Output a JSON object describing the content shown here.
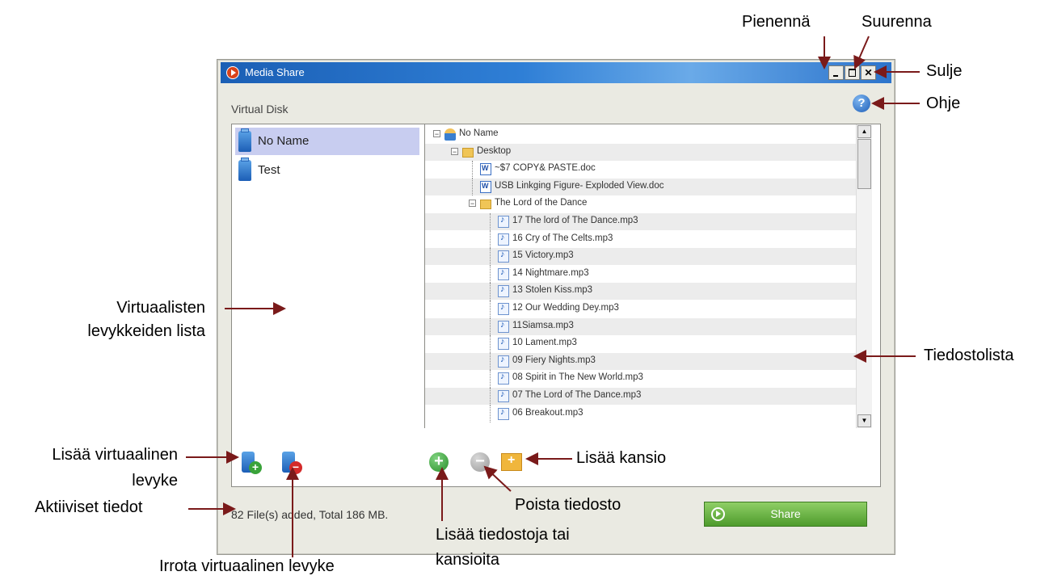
{
  "window": {
    "title": "Media Share",
    "section_label": "Virtual Disk",
    "help_label": "?",
    "close_symbol": "✕"
  },
  "disks": [
    {
      "name": "No Name",
      "selected": true
    },
    {
      "name": "Test",
      "selected": false
    }
  ],
  "tree": [
    {
      "label": "No Name",
      "icon": "user-icon",
      "level": 0,
      "toggle": "−"
    },
    {
      "label": "Desktop",
      "icon": "folder-icon",
      "level": 1,
      "toggle": "−"
    },
    {
      "label": "~$7 COPY& PASTE.doc",
      "icon": "doc-icon",
      "level": 2
    },
    {
      "label": "USB Linkging Figure- Exploded View.doc",
      "icon": "doc-icon",
      "level": 2
    },
    {
      "label": "The Lord of the Dance",
      "icon": "folder-icon",
      "level": 2,
      "toggle": "−"
    },
    {
      "label": "17 The lord of The Dance.mp3",
      "icon": "mp3-icon",
      "level": 3
    },
    {
      "label": "16 Cry of The Celts.mp3",
      "icon": "mp3-icon",
      "level": 3
    },
    {
      "label": "15 Victory.mp3",
      "icon": "mp3-icon",
      "level": 3
    },
    {
      "label": "14 Nightmare.mp3",
      "icon": "mp3-icon",
      "level": 3
    },
    {
      "label": "13 Stolen Kiss.mp3",
      "icon": "mp3-icon",
      "level": 3
    },
    {
      "label": "12 Our Wedding Dey.mp3",
      "icon": "mp3-icon",
      "level": 3
    },
    {
      "label": "11Siamsa.mp3",
      "icon": "mp3-icon",
      "level": 3
    },
    {
      "label": "10 Lament.mp3",
      "icon": "mp3-icon",
      "level": 3
    },
    {
      "label": "09 Fiery Nights.mp3",
      "icon": "mp3-icon",
      "level": 3
    },
    {
      "label": "08 Spirit in The New World.mp3",
      "icon": "mp3-icon",
      "level": 3
    },
    {
      "label": "07 The Lord of The Dance.mp3",
      "icon": "mp3-icon",
      "level": 3
    },
    {
      "label": "06 Breakout.mp3",
      "icon": "mp3-icon",
      "level": 3
    }
  ],
  "status": {
    "text": "82 File(s) added, Total 186 MB."
  },
  "share": {
    "label": "Share"
  },
  "annotations": {
    "minimize": "Pienennä",
    "maximize": "Suurenna",
    "close": "Sulje",
    "help": "Ohje",
    "disk_list_1": "Virtuaalisten",
    "disk_list_2": "levykkeiden lista",
    "file_list": "Tiedostolista",
    "add_disk_1": "Lisää virtuaalinen",
    "add_disk_2": "levyke",
    "status_info": "Aktiiviset tiedot",
    "remove_disk": "Irrota virtuaalinen levyke",
    "add_folder": "Lisää kansio",
    "remove_file": "Poista tiedosto",
    "add_files_1": "Lisää tiedostoja tai",
    "add_files_2": "kansioita"
  },
  "colors": {
    "arrow": "#7a1a1a",
    "titlebar": "#1b5fb5",
    "share": "#4e9b2c",
    "selected": "#c8cdf0"
  }
}
